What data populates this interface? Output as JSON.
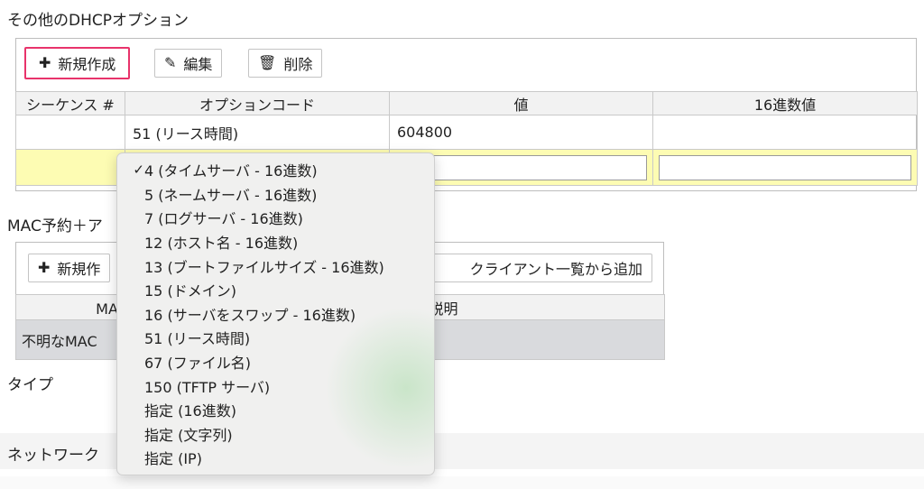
{
  "dhcp": {
    "title": "その他のDHCPオプション",
    "buttons": {
      "new": "新規作成",
      "edit": "編集",
      "delete": "削除"
    },
    "columns": [
      "シーケンス #",
      "オプションコード",
      "値",
      "16進数値"
    ],
    "rows": [
      {
        "seq": "",
        "code": "51 (リース時間)",
        "value": "604800",
        "hex": ""
      }
    ]
  },
  "mac": {
    "title": "MAC予約＋ア",
    "buttons": {
      "new": "新規作",
      "add_from_list": "クライアント一覧から追加"
    },
    "columns": [
      "MACア",
      "説明"
    ],
    "rows": [
      {
        "mac": "不明なMAC",
        "desc": ""
      }
    ]
  },
  "labels": {
    "type": "タイプ",
    "network": "ネットワーク"
  },
  "dropdown": {
    "selected_index": 0,
    "options": [
      "4 (タイムサーバ - 16進数)",
      "5 (ネームサーバ - 16進数)",
      "7 (ログサーバ - 16進数)",
      "12 (ホスト名 - 16進数)",
      "13 (ブートファイルサイズ - 16進数)",
      "15 (ドメイン)",
      "16 (サーバをスワップ - 16進数)",
      "51 (リース時間)",
      "67 (ファイル名)",
      "150 (TFTP サーバ)",
      "指定 (16進数)",
      "指定 (文字列)",
      "指定 (IP)"
    ]
  },
  "colors": {
    "highlight": "#e8336b",
    "new_row": "#fdfcb3",
    "grey_row": "#d9dadd"
  }
}
